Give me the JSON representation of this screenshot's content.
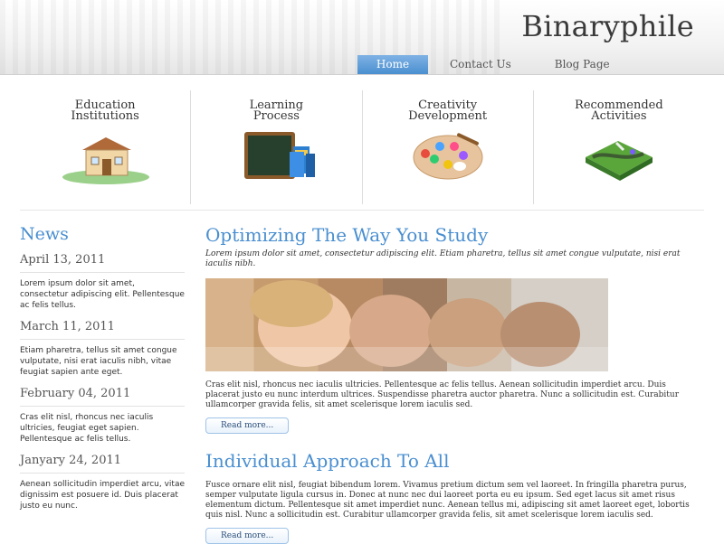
{
  "header": {
    "brand": "Binaryphile",
    "nav": [
      "Home",
      "Contact Us",
      "Blog Page"
    ]
  },
  "features": [
    {
      "title_line1": "Education",
      "title_line2": "Institutions",
      "icon": "house-icon"
    },
    {
      "title_line1": "Learning",
      "title_line2": "Process",
      "icon": "chalkboard-books-icon"
    },
    {
      "title_line1": "Creativity",
      "title_line2": "Development",
      "icon": "paint-palette-icon"
    },
    {
      "title_line1": "Recommended",
      "title_line2": "Activities",
      "icon": "map-terrain-icon"
    }
  ],
  "sidebar": {
    "title": "News",
    "items": [
      {
        "date": "April 13, 2011",
        "text": "Lorem ipsum dolor sit amet, consectetur adipiscing elit. Pellentesque ac felis tellus."
      },
      {
        "date": "March 11, 2011",
        "text": "Etiam pharetra, tellus sit amet congue vulputate, nisi erat iaculis nibh, vitae feugiat sapien ante eget."
      },
      {
        "date": "February 04, 2011",
        "text": "Cras elit nisl, rhoncus nec iaculis ultricies, feugiat eget sapien. Pellentesque ac felis tellus."
      },
      {
        "date": "Janyary 24, 2011",
        "text": "Aenean sollicitudin imperdiet arcu, vitae dignissim est posuere id. Duis placerat justo eu nunc."
      }
    ]
  },
  "posts": [
    {
      "title": "Optimizing The Way You Study",
      "intro": "Lorem ipsum dolor sit amet, consectetur adipiscing elit. Etiam pharetra, tellus sit amet congue vulputate, nisi erat iaculis nibh.",
      "body": "Cras elit nisl, rhoncus nec iaculis ultricies. Pellentesque ac felis tellus. Aenean sollicitudin imperdiet arcu. Duis placerat justo eu nunc interdum ultrices. Suspendisse pharetra auctor pharetra. Nunc a sollicitudin est. Curabitur ullamcorper gravida felis, sit amet scelerisque lorem iaculis sed.",
      "readmore": "Read more..."
    },
    {
      "title": "Individual Approach To All",
      "body": "Fusce ornare elit nisl, feugiat bibendum lorem. Vivamus pretium dictum sem vel laoreet. In fringilla pharetra purus, semper vulputate ligula cursus in. Donec at nunc nec dui laoreet porta eu eu ipsum. Sed eget lacus sit amet risus elementum dictum. Pellentesque sit amet imperdiet nunc. Aenean tellus mi, adipiscing sit amet laoreet eget, lobortis quis nisl. Nunc a sollicitudin est. Curabitur ullamcorper gravida felis, sit amet scelerisque lorem iaculis sed.",
      "readmore": "Read more..."
    }
  ],
  "colors": {
    "accent": "#4a8fd0",
    "nav_active": "#5a9ad8"
  }
}
